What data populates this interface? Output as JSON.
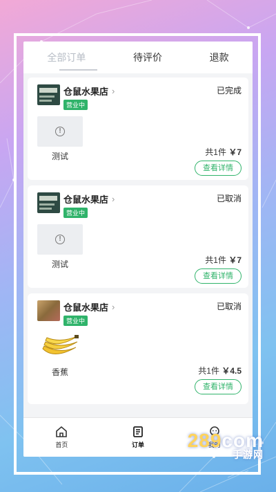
{
  "tabs": [
    {
      "label": "全部订单"
    },
    {
      "label": "待评价"
    },
    {
      "label": "退款"
    }
  ],
  "orders": [
    {
      "store_name": "仓鼠水果店",
      "store_badge": "营业中",
      "status": "已完成",
      "product_name": "测试",
      "summary_count": "共1件",
      "summary_price": "￥7",
      "detail_button": "查看详情",
      "image": "placeholder-icon"
    },
    {
      "store_name": "仓鼠水果店",
      "store_badge": "营业中",
      "status": "已取消",
      "product_name": "测试",
      "summary_count": "共1件",
      "summary_price": "￥7",
      "detail_button": "查看详情",
      "image": "placeholder-icon"
    },
    {
      "store_name": "仓鼠水果店",
      "store_badge": "营业中",
      "status": "已取消",
      "product_name": "香蕉",
      "summary_count": "共1件",
      "summary_price": "￥4.5",
      "detail_button": "查看详情",
      "image": "banana-image"
    }
  ],
  "tabbar": [
    {
      "label": "首页",
      "icon": "home-icon"
    },
    {
      "label": "订单",
      "icon": "order-icon"
    },
    {
      "label": "我的",
      "icon": "profile-icon"
    }
  ],
  "watermark": {
    "main": "289",
    "suffix": "com",
    "sub": "手游网"
  },
  "colors": {
    "accent": "#2fb36a",
    "badge": "#2fb36a"
  }
}
